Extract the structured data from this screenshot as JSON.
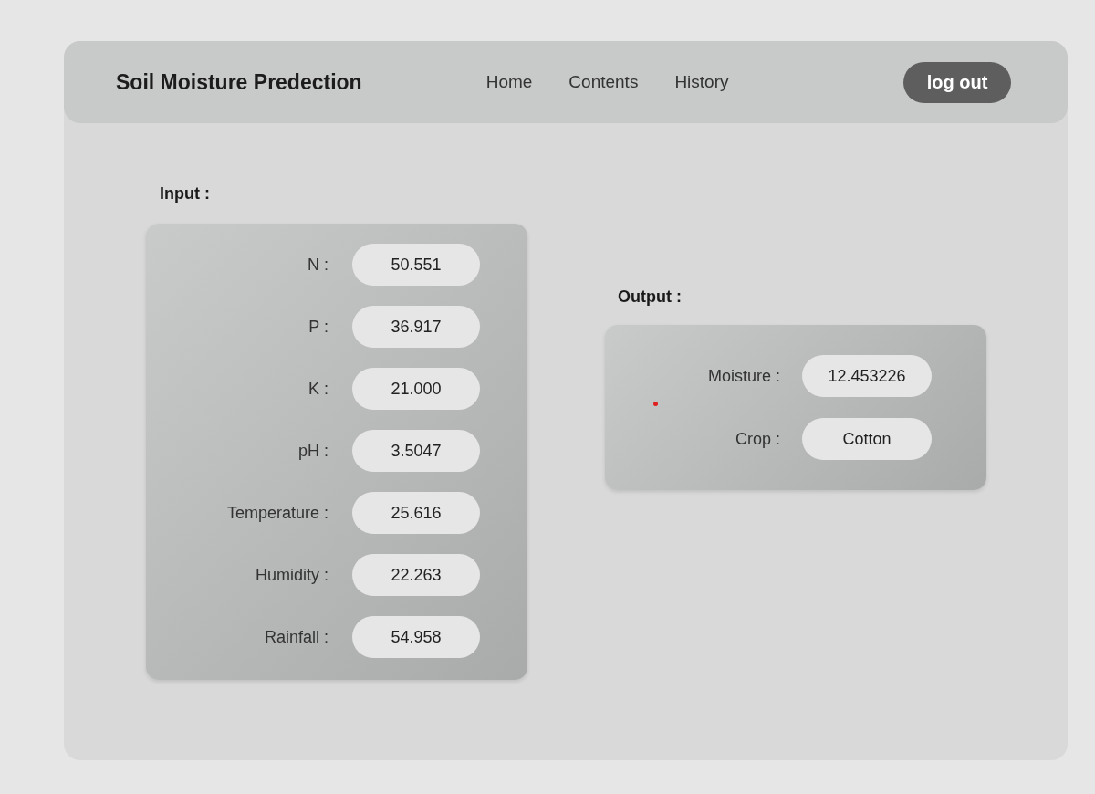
{
  "header": {
    "title": "Soil Moisture Predection",
    "nav": [
      "Home",
      "Contents",
      "History"
    ],
    "logout": "log out"
  },
  "input": {
    "label": "Input :",
    "fields": [
      {
        "label": "N :",
        "value": "50.551"
      },
      {
        "label": "P :",
        "value": "36.917"
      },
      {
        "label": "K :",
        "value": "21.000"
      },
      {
        "label": "pH :",
        "value": "3.5047"
      },
      {
        "label": "Temperature :",
        "value": "25.616"
      },
      {
        "label": "Humidity :",
        "value": "22.263"
      },
      {
        "label": "Rainfall :",
        "value": "54.958"
      }
    ]
  },
  "output": {
    "label": "Output :",
    "fields": [
      {
        "label": "Moisture :",
        "value": "12.453226"
      },
      {
        "label": "Crop :",
        "value": "Cotton"
      }
    ]
  }
}
